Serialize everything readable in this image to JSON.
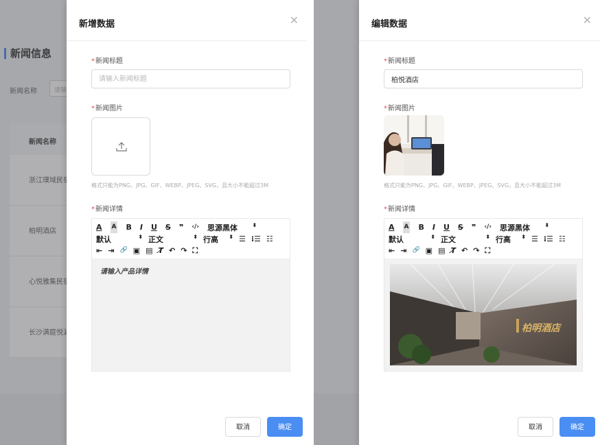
{
  "background": {
    "page_title": "新闻信息",
    "filter_label": "新闻名称",
    "filter_placeholder": "请输",
    "table": {
      "header": "新闻名称",
      "rows": [
        "浙江璞域民宿",
        "柏明酒店",
        "心悦雅集民宿",
        "长沙满庭悦酒"
      ]
    }
  },
  "add_drawer": {
    "title": "新增数据",
    "close_icon": "close-icon",
    "title_label": "新闻标题",
    "title_placeholder": "请输入新闻标题",
    "image_label": "新闻图片",
    "upload_icon": "upload-icon",
    "hint": "格式只能为PNG、JPG、GIF、WEBP、JPEG、SVG，且大小不能超过3M",
    "detail_label": "新闻详情",
    "editor_placeholder": "请输入产品详情",
    "cancel": "取消",
    "confirm": "确定"
  },
  "edit_drawer": {
    "title": "编辑数据",
    "close_icon": "close-icon",
    "title_label": "新闻标题",
    "title_value": "柏悦酒店",
    "image_label": "新闻图片",
    "hint": "格式只能为PNG、JPG、GIF、WEBP、JPEG、SVG，且大小不能超过3M",
    "detail_label": "新闻详情",
    "image_sign_text": "柏明酒店",
    "cancel": "取消",
    "confirm": "确定"
  },
  "toolbar": {
    "font_color": "A",
    "bg_color": "A",
    "bold": "B",
    "italic": "I",
    "underline": "U",
    "strike": "S",
    "quote": "❞",
    "code": "‹/›",
    "font_family": "思源黑体",
    "size_default": "默认",
    "paragraph": "正文",
    "line_height": "行高",
    "select_arrow": "⬍",
    "align": "☰",
    "ordered_list": "⁝☰",
    "bullet_list": "☷",
    "indent": "⇤",
    "outdent": "⇥",
    "link": "🔗",
    "image": "▣",
    "video": "▤",
    "clear_format": "T̸",
    "undo": "↶",
    "redo": "↷",
    "fullscreen": "⛶"
  },
  "colors": {
    "primary": "#4b8ef3",
    "required": "#e5484d",
    "accent_bar": "#3a7bf0",
    "overlay": "#5a5a5f"
  }
}
